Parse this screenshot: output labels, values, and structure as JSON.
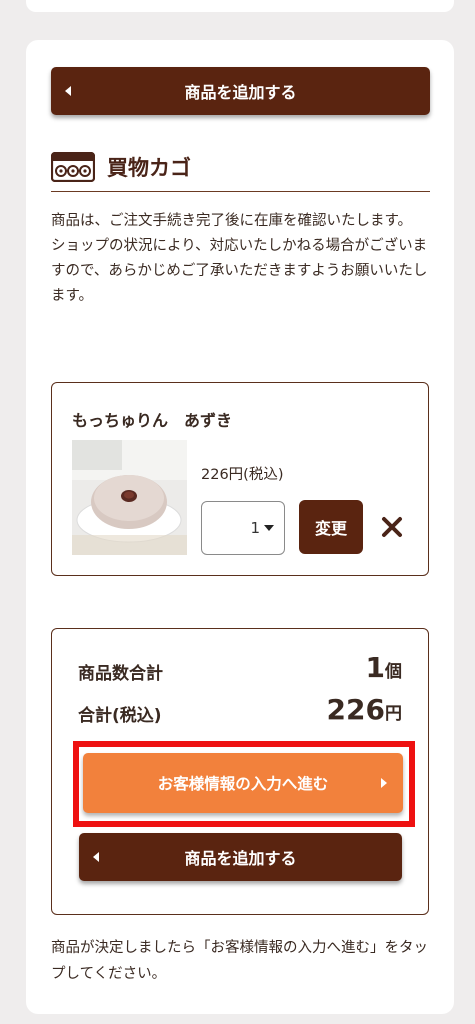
{
  "buttons": {
    "add_product": "商品を追加する",
    "proceed": "お客様情報の入力へ進む",
    "change": "変更"
  },
  "cart": {
    "title": "買物カゴ",
    "notice": [
      "商品は、ご注文手続き完了後に在庫を確認いたします。",
      "ショップの状況により、対応いたしかねる場合がございますので、あらかじめご了承いただきますようお願いいたします。"
    ]
  },
  "item": {
    "name": "もっちゅりん　あずき",
    "price": "226円(税込)",
    "quantity": "1"
  },
  "summary": {
    "count_label": "商品数合計",
    "count_value": "1",
    "count_unit": "個",
    "total_label": "合計(税込)",
    "total_value": "226",
    "total_unit": "円"
  },
  "footer_note": "商品が決定しましたら「お客様情報の入力へ進む」をタップしてください。",
  "colors": {
    "brand_brown": "#5a2410",
    "accent_orange": "#f2813c",
    "highlight_red": "#ee1111"
  },
  "icons": {
    "cart": "cart-icon",
    "remove": "close-icon",
    "back": "chevron-left-icon",
    "forward": "chevron-right-icon",
    "dropdown": "caret-down-icon"
  }
}
